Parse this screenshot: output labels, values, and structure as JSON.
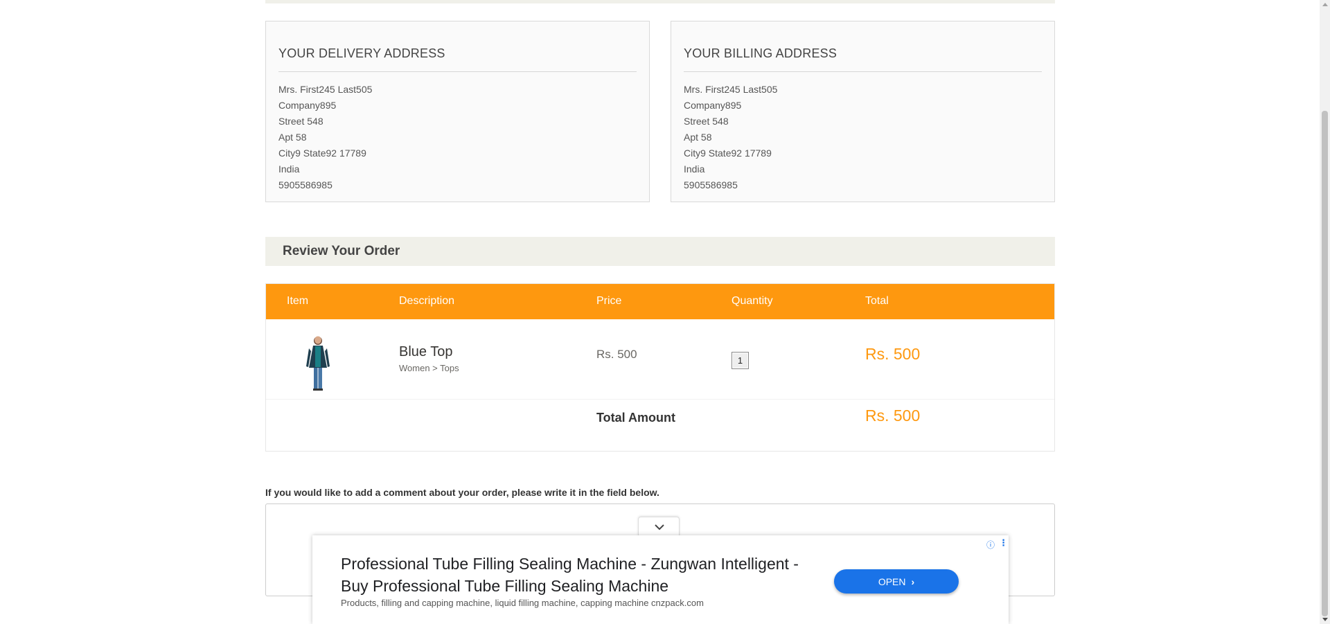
{
  "delivery": {
    "title": "YOUR DELIVERY ADDRESS",
    "lines": [
      "Mrs. First245 Last505",
      "Company895",
      "Street 548",
      "Apt 58",
      "City9 State92 17789",
      "India",
      "5905586985"
    ]
  },
  "billing": {
    "title": "YOUR BILLING ADDRESS",
    "lines": [
      "Mrs. First245 Last505",
      "Company895",
      "Street 548",
      "Apt 58",
      "City9 State92 17789",
      "India",
      "5905586985"
    ]
  },
  "review": {
    "title": "Review Your Order"
  },
  "cart": {
    "headers": [
      "Item",
      "Description",
      "Price",
      "Quantity",
      "Total"
    ],
    "items": [
      {
        "name": "Blue Top",
        "category": "Women > Tops",
        "price": "Rs. 500",
        "quantity": "1",
        "total": "Rs. 500"
      }
    ],
    "total_label": "Total Amount",
    "total_value": "Rs. 500"
  },
  "comment": {
    "label": "If you would like to add a comment about your order, please write it in the field below.",
    "value": ""
  },
  "ad": {
    "headline": "Professional Tube Filling Sealing Machine - Zungwan Intelligent - Buy Professional Tube Filling Sealing Machine",
    "subtext": "Products, filling and capping machine, liquid filling machine, capping machine cnzpack.com",
    "open_label": "OPEN",
    "open_color": "#1a73e8"
  },
  "colors": {
    "accent": "#fe980f",
    "panel": "#f0f0e9"
  }
}
